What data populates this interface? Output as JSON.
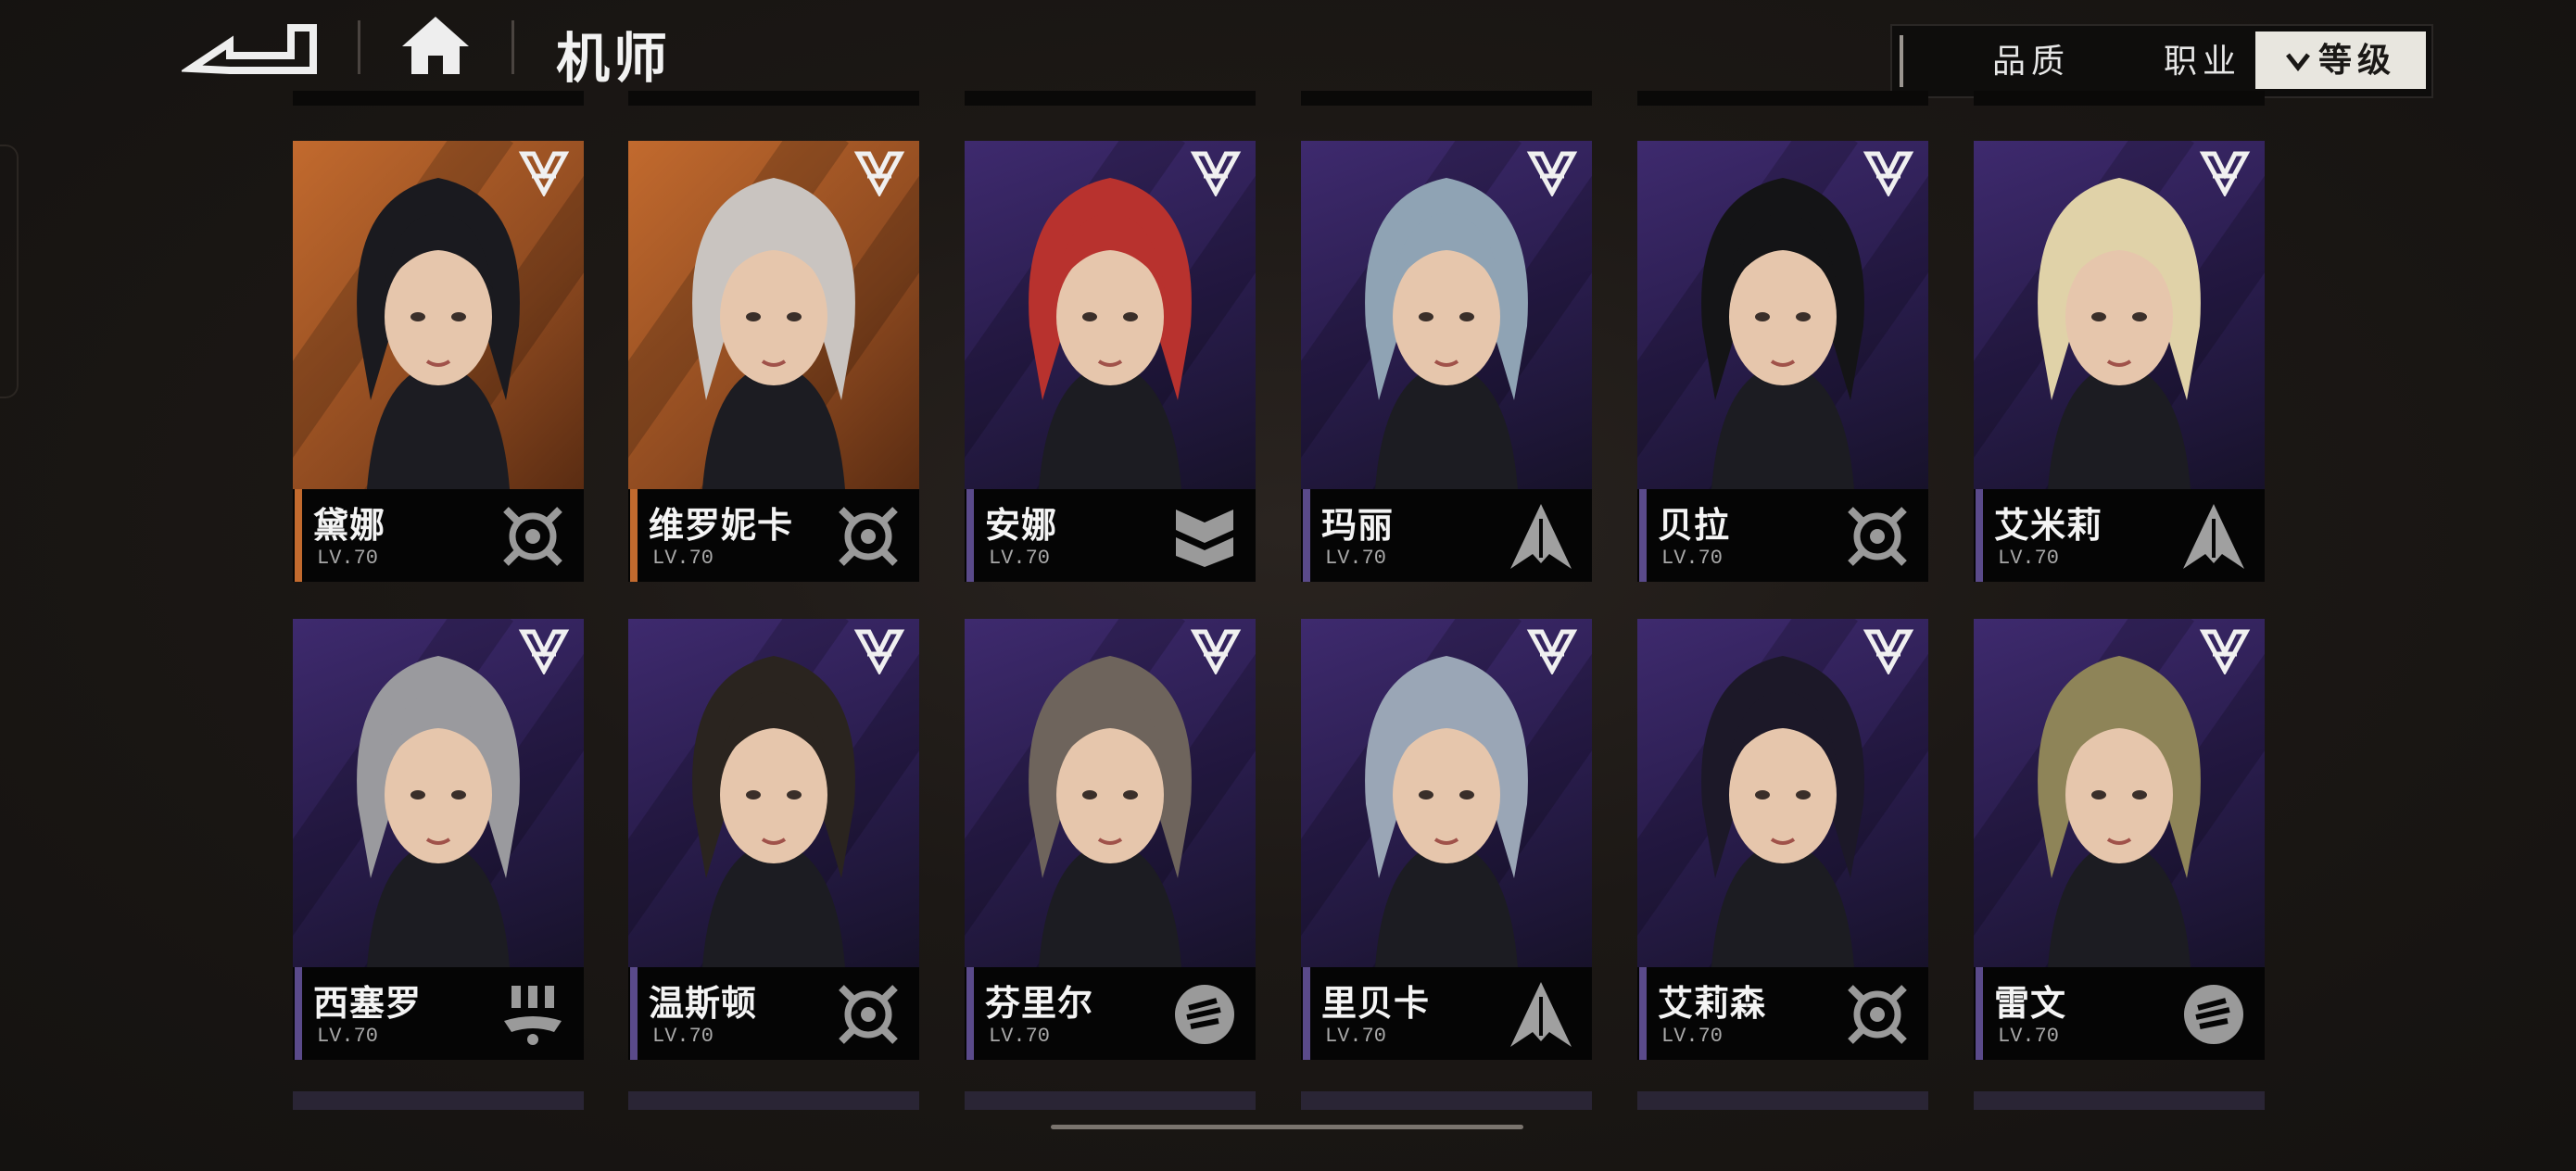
{
  "header": {
    "title": "机师",
    "back_icon": "back-arrow-icon",
    "home_icon": "home-icon"
  },
  "filters": {
    "quality": "品质",
    "job": "职业",
    "level": "等级",
    "active": "level"
  },
  "colors": {
    "orange_rank_bg": "#c26a2e",
    "purple_rank_bg": "#3e2a6e",
    "active_filter_bg": "#e8e6df"
  },
  "pilots": [
    {
      "name": "黛娜",
      "level": "LV.70",
      "role_icon": "target-crosshair-icon",
      "rarity": "orange"
    },
    {
      "name": "维罗妮卡",
      "level": "LV.70",
      "role_icon": "target-crosshair-icon",
      "rarity": "orange"
    },
    {
      "name": "安娜",
      "level": "LV.70",
      "role_icon": "shield-chevron-icon",
      "rarity": "purple"
    },
    {
      "name": "玛丽",
      "level": "LV.70",
      "role_icon": "arrow-spike-icon",
      "rarity": "purple"
    },
    {
      "name": "贝拉",
      "level": "LV.70",
      "role_icon": "target-crosshair-icon",
      "rarity": "purple"
    },
    {
      "name": "艾米莉",
      "level": "LV.70",
      "role_icon": "arrow-spike-icon",
      "rarity": "purple"
    },
    {
      "name": "西塞罗",
      "level": "LV.70",
      "role_icon": "support-drone-icon",
      "rarity": "purple"
    },
    {
      "name": "温斯顿",
      "level": "LV.70",
      "role_icon": "target-crosshair-icon",
      "rarity": "purple"
    },
    {
      "name": "芬里尔",
      "level": "LV.70",
      "role_icon": "fist-icon",
      "rarity": "purple"
    },
    {
      "name": "里贝卡",
      "level": "LV.70",
      "role_icon": "arrow-spike-icon",
      "rarity": "purple"
    },
    {
      "name": "艾莉森",
      "level": "LV.70",
      "role_icon": "target-crosshair-icon",
      "rarity": "purple"
    },
    {
      "name": "雷文",
      "level": "LV.70",
      "role_icon": "fist-icon",
      "rarity": "purple"
    }
  ]
}
